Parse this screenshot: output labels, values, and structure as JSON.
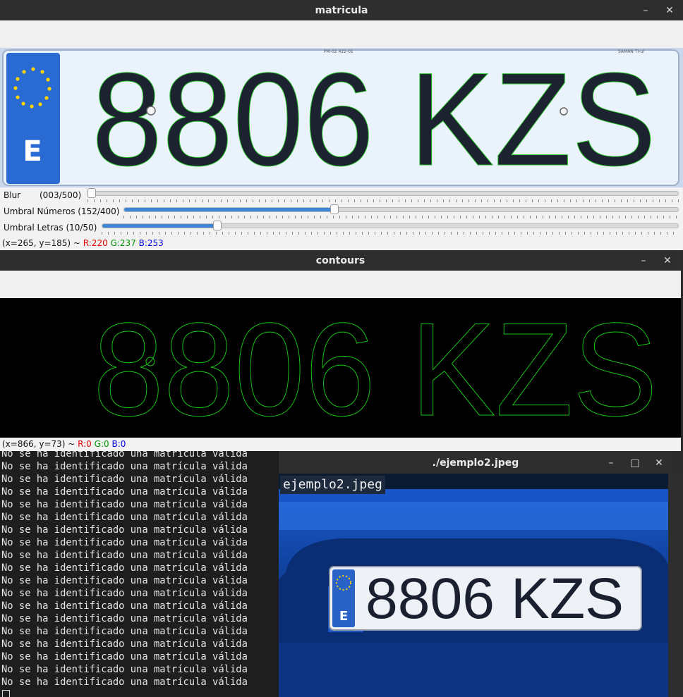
{
  "window_matricula": {
    "title": "matricula",
    "plate_text": "8806 KZS",
    "plate_country": "E",
    "plate_top_text_left": "PM-02 422-01",
    "plate_top_text_right": "SAMAN TI-ul",
    "trackbars": [
      {
        "label": "Blur",
        "value_text": "(003/500)",
        "value": 3,
        "max": 500
      },
      {
        "label": "Umbral Números (152/400)",
        "value_text": "",
        "value": 152,
        "max": 400
      },
      {
        "label": "Umbral Letras (10/50)",
        "value_text": "",
        "value": 10,
        "max": 50
      }
    ],
    "status": {
      "prefix": "(x=265, y=185) ~ ",
      "r": "R:220",
      "g": "G:237",
      "b": "B:253"
    }
  },
  "window_contours": {
    "title": "contours",
    "contour_text": "8806 KZS",
    "status": {
      "prefix": "(x=866, y=73) ~ ",
      "r": "R:0",
      "g": "G:0",
      "b": "B:0"
    }
  },
  "terminal": {
    "lines": [
      "No se ha identificado una matrícula válida",
      "No se ha identificado una matrícula válida",
      "No se ha identificado una matrícula válida",
      "No se ha identificado una matrícula válida",
      "No se ha identificado una matrícula válida",
      "No se ha identificado una matrícula válida",
      "No se ha identificado una matrícula válida",
      "No se ha identificado una matrícula válida",
      "No se ha identificado una matrícula válida",
      "No se ha identificado una matrícula válida",
      "No se ha identificado una matrícula válida",
      "No se ha identificado una matrícula válida",
      "No se ha identificado una matrícula válida",
      "No se ha identificado una matrícula válida",
      "No se ha identificado una matrícula válida",
      "No se ha identificado una matrícula válida",
      "No se ha identificado una matrícula válida",
      "No se ha identificado una matrícula válida",
      "No se ha identificado una matrícula válida"
    ]
  },
  "window_ejemplo": {
    "title": "./ejemplo2.jpeg",
    "overlay_label": "ejemplo2.jpeg",
    "plate_text": "8806 KZS",
    "plate_country": "E"
  },
  "icons": [
    "minimize-icon",
    "maximize-icon",
    "close-icon"
  ],
  "colors": {
    "contour_green": "#19c619",
    "plate_blue": "#1f5fc8",
    "car_blue": "#1447a8"
  }
}
